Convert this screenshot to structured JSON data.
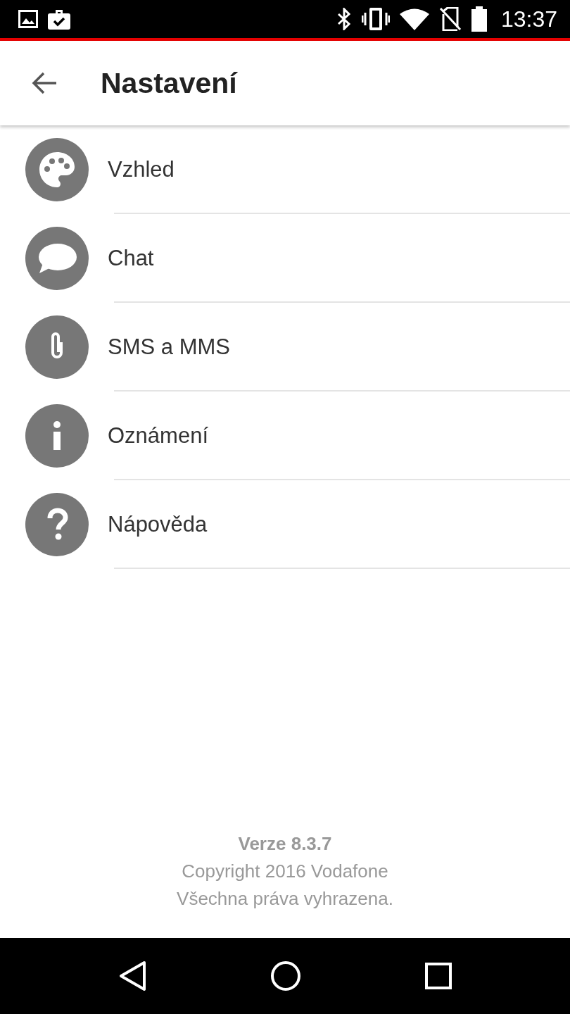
{
  "status_bar": {
    "time": "13:37"
  },
  "app_bar": {
    "title": "Nastavení"
  },
  "items": [
    {
      "label": "Vzhled"
    },
    {
      "label": "Chat"
    },
    {
      "label": "SMS a MMS"
    },
    {
      "label": "Oznámení"
    },
    {
      "label": "Nápověda"
    }
  ],
  "footer": {
    "version": "Verze 8.3.7",
    "copyright": "Copyright 2016 Vodafone",
    "rights": "Všechna práva vyhrazena."
  }
}
